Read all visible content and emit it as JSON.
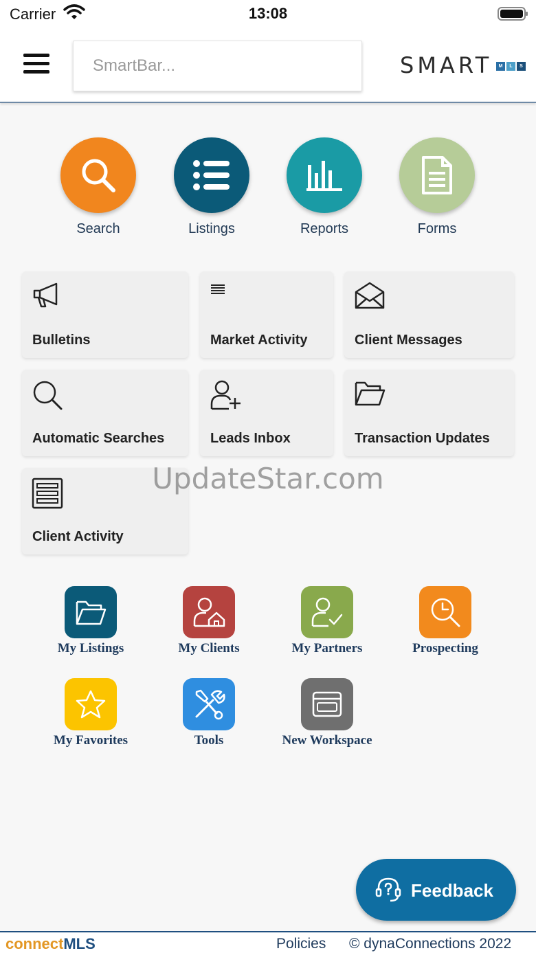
{
  "status": {
    "carrier": "Carrier",
    "time": "13:08"
  },
  "header": {
    "search_placeholder": "SmartBar...",
    "logo_text": "SMART",
    "logo_blocks": [
      "M",
      "L",
      "S"
    ],
    "colors": {
      "border": "#6f8aa6"
    }
  },
  "quick_actions": [
    {
      "label": "Search",
      "icon": "search-icon",
      "color": "#f1861e"
    },
    {
      "label": "Listings",
      "icon": "list-icon",
      "color": "#0b5a78"
    },
    {
      "label": "Reports",
      "icon": "bar-chart-icon",
      "color": "#1a9ba5"
    },
    {
      "label": "Forms",
      "icon": "document-icon",
      "color": "#b6cc98"
    }
  ],
  "tiles": [
    {
      "label": "Bulletins",
      "icon": "megaphone-icon"
    },
    {
      "label": "Market Activity",
      "icon": "lines-icon"
    },
    {
      "label": "Client Messages",
      "icon": "envelope-open-icon"
    },
    {
      "label": "Automatic Searches",
      "icon": "search-icon"
    },
    {
      "label": "Leads Inbox",
      "icon": "user-add-icon"
    },
    {
      "label": "Transaction Updates",
      "icon": "folder-icon"
    },
    {
      "label": "Client Activity",
      "icon": "list-box-icon"
    }
  ],
  "watermark": "UpdateStar.com",
  "apps": [
    {
      "label": "My Listings",
      "icon": "folder-icon",
      "color": "#0b5a78"
    },
    {
      "label": "My Clients",
      "icon": "user-home-icon",
      "color": "#b5433f"
    },
    {
      "label": "My Partners",
      "icon": "user-check-icon",
      "color": "#89a94c"
    },
    {
      "label": "Prospecting",
      "icon": "clock-search-icon",
      "color": "#f28a1d"
    },
    {
      "label": "My Favorites",
      "icon": "star-icon",
      "color": "#fcc400"
    },
    {
      "label": "Tools",
      "icon": "tools-icon",
      "color": "#2f8ee0"
    },
    {
      "label": "New Workspace",
      "icon": "window-icon",
      "color": "#6f6f6f"
    }
  ],
  "feedback": {
    "label": "Feedback",
    "color": "#0f6ea2"
  },
  "footer": {
    "brand_part1": "connect",
    "brand_part2": "MLS",
    "policies": "Policies",
    "copyright": "© dynaConnections 2022"
  }
}
